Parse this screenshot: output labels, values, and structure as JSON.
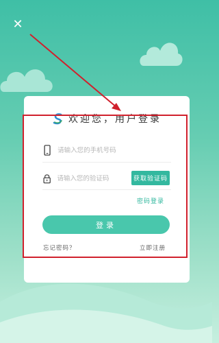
{
  "header": {
    "close_icon": "close-icon"
  },
  "brand": {
    "title": "欢迎您，用户登录",
    "logo_icon": "brand-logo-icon"
  },
  "phone_field": {
    "placeholder": "请输入您的手机号码",
    "icon": "phone-icon"
  },
  "code_field": {
    "placeholder": "请输入您的验证码",
    "icon": "lock-icon"
  },
  "buttons": {
    "get_code": "获取验证码",
    "password_login": "密码登录",
    "login": "登录",
    "forgot_password": "忘记密码？",
    "register": "立即注册"
  },
  "colors": {
    "accent": "#33b89f",
    "login_button": "#49c7ac",
    "annotation": "#d0202c",
    "background_top": "#3fbfa6",
    "background_bottom": "#c6efdf"
  }
}
